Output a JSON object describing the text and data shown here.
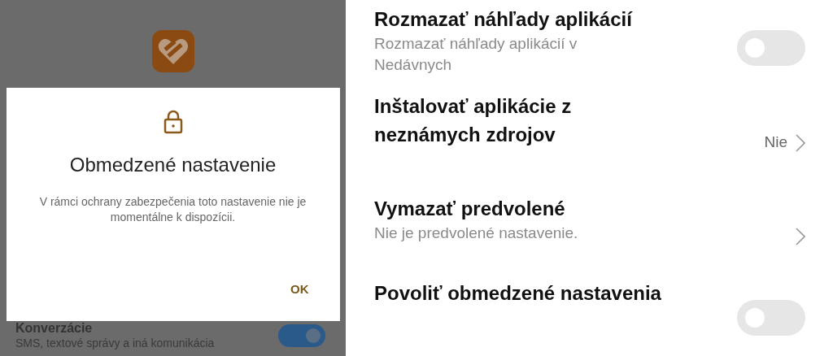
{
  "left_screen": {
    "behind": {
      "title": "Konverzácie",
      "subtitle": "SMS, textové správy a iná komunikácia",
      "on": true
    },
    "dialog": {
      "title": "Obmedzené nastavenie",
      "message": "V rámci ochrany zabezpečenia toto nastavenie nie je momentálne k dispozícii.",
      "button": "OK"
    }
  },
  "settings": [
    {
      "kind": "toggle",
      "title": "Rozmazať náhľady aplikácií",
      "subtitle": "Rozmazať náhľady aplikácií v Nedávnych",
      "on": false
    },
    {
      "kind": "link",
      "title": "Inštalovať aplikácie z neznámych zdrojov",
      "value": "Nie"
    },
    {
      "kind": "link",
      "title": "Vymazať predvolené",
      "subtitle": "Nie je predvolené nastavenie."
    },
    {
      "kind": "toggle",
      "title": "Povoliť obmedzené nastavenia",
      "on": false
    }
  ]
}
